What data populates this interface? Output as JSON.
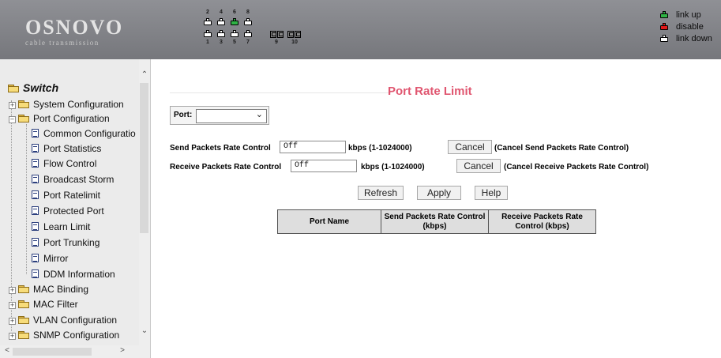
{
  "header": {
    "brand": "OSNOVO",
    "tagline": "cable transmission",
    "ports_top_numbers": [
      "2",
      "4",
      "6",
      "8"
    ],
    "ports_bottom_numbers": [
      "1",
      "3",
      "5",
      "7"
    ],
    "sfp_numbers": [
      "9",
      "10"
    ],
    "legend": [
      {
        "label": "link up",
        "color": "#2fb345"
      },
      {
        "label": "disable",
        "color": "#e01919"
      },
      {
        "label": "link down",
        "color": "#ffffff"
      }
    ]
  },
  "sidebar": {
    "root": "Switch",
    "items": [
      {
        "label": "System Configuration"
      },
      {
        "label": "Port Configuration"
      },
      {
        "label": "Common Configuratio"
      },
      {
        "label": "Port Statistics"
      },
      {
        "label": "Flow Control"
      },
      {
        "label": "Broadcast Storm"
      },
      {
        "label": "Port Ratelimit"
      },
      {
        "label": "Protected Port"
      },
      {
        "label": "Learn Limit"
      },
      {
        "label": "Port Trunking"
      },
      {
        "label": "Mirror"
      },
      {
        "label": "DDM Information"
      },
      {
        "label": "MAC Binding"
      },
      {
        "label": "MAC Filter"
      },
      {
        "label": "VLAN Configuration"
      },
      {
        "label": "SNMP Configuration"
      }
    ]
  },
  "main": {
    "title": "Port Rate Limit",
    "port_label": "Port:",
    "port_value": "",
    "send": {
      "label": "Send Packets Rate Control",
      "value": "Off",
      "unit": "kbps (1-1024000)",
      "cancel": "Cancel",
      "note": "(Cancel Send Packets Rate Control)"
    },
    "receive": {
      "label": "Receive Packets Rate Control",
      "value": "Off",
      "unit": "kbps (1-1024000)",
      "cancel": "Cancel",
      "note": "(Cancel Receive Packets Rate Control)"
    },
    "buttons": {
      "refresh": "Refresh",
      "apply": "Apply",
      "help": "Help"
    },
    "table": {
      "columns": [
        "Port Name",
        "Send Packets Rate Control (kbps)",
        "Receive Packets Rate Control (kbps)"
      ]
    }
  },
  "colors": {
    "title": "#e05670",
    "header_bg": "#808187",
    "port_up": "#2fb345"
  }
}
